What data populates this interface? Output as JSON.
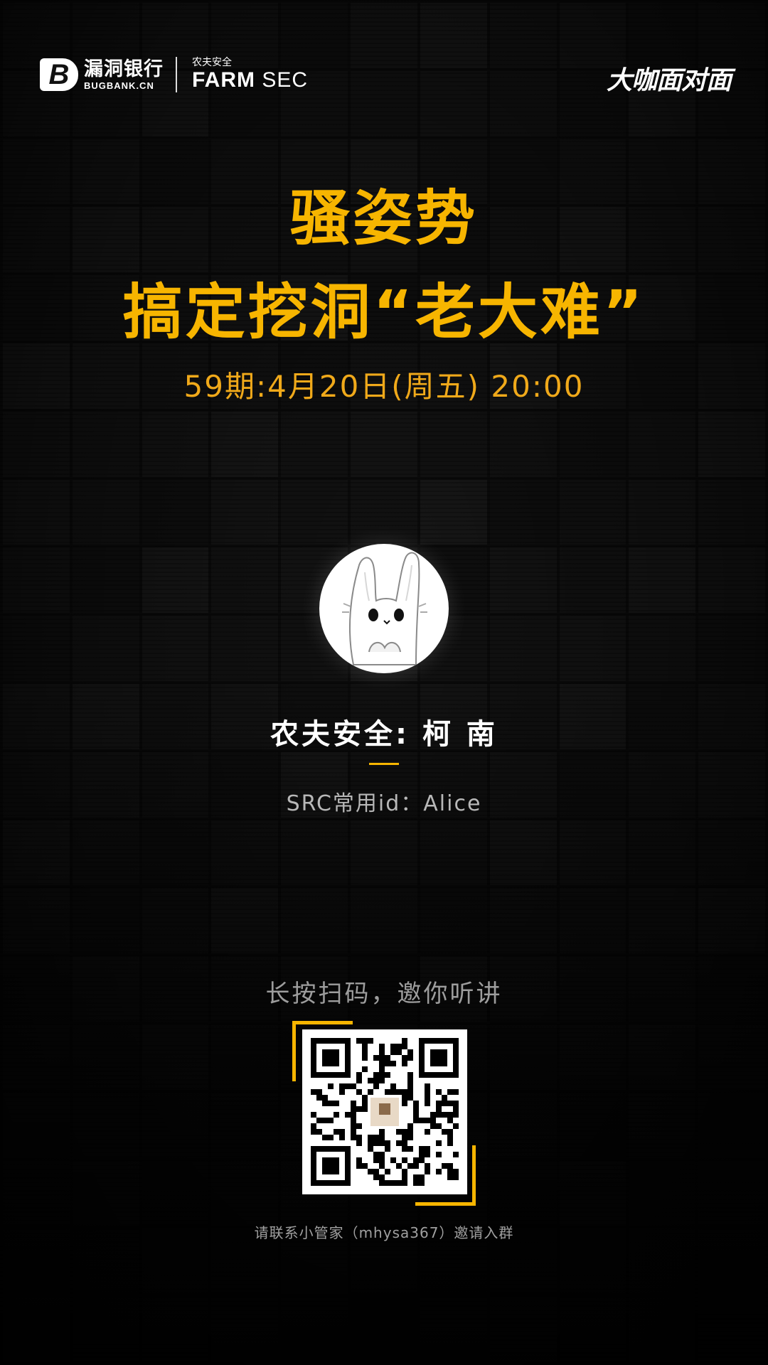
{
  "header": {
    "bugbank_mark": "B",
    "bugbank_cn": "漏洞银行",
    "bugbank_en": "BUGBANK.CN",
    "farm_cn": "农夫安全",
    "farm_en": "FARM",
    "farm_sec": "SEC",
    "series_logo": "大咖面对面"
  },
  "title": {
    "line1": "骚姿势",
    "line2": "搞定挖洞“老大难”",
    "date": "59期:4月20日(周五) 20:00"
  },
  "speaker": {
    "name": "农夫安全: 柯 南",
    "src_id": "SRC常用id：Alice",
    "avatar_icon": "rabbit-avatar-icon"
  },
  "qr": {
    "caption": "长按扫码，邀你听讲",
    "contact": "请联系小管家（mhysa367）邀请入群"
  },
  "colors": {
    "accent": "#f7b500",
    "background": "#0b0b0b"
  }
}
